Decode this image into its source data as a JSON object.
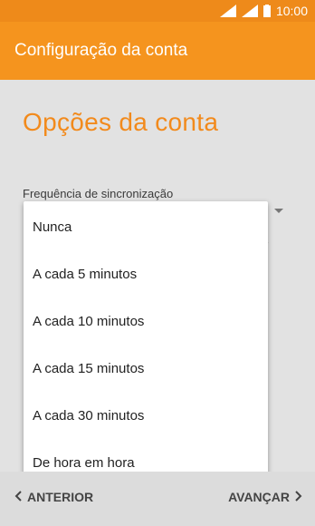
{
  "status_bar": {
    "time": "10:00"
  },
  "app_bar": {
    "title": "Configuração da conta"
  },
  "page": {
    "heading": "Opções da conta",
    "sync_label": "Frequência de sincronização",
    "partial_text": "r"
  },
  "dropdown_menu": {
    "options": [
      "Nunca",
      "A cada 5 minutos",
      "A cada 10 minutos",
      "A cada 15 minutos",
      "A cada 30 minutos",
      "De hora em hora"
    ]
  },
  "navigation": {
    "prev_label": "ANTERIOR",
    "next_label": "AVANÇAR"
  },
  "colors": {
    "status_bar": "#ee8a1a",
    "app_bar": "#f5941e",
    "heading": "#f28a1c",
    "background": "#e2e2e2"
  }
}
